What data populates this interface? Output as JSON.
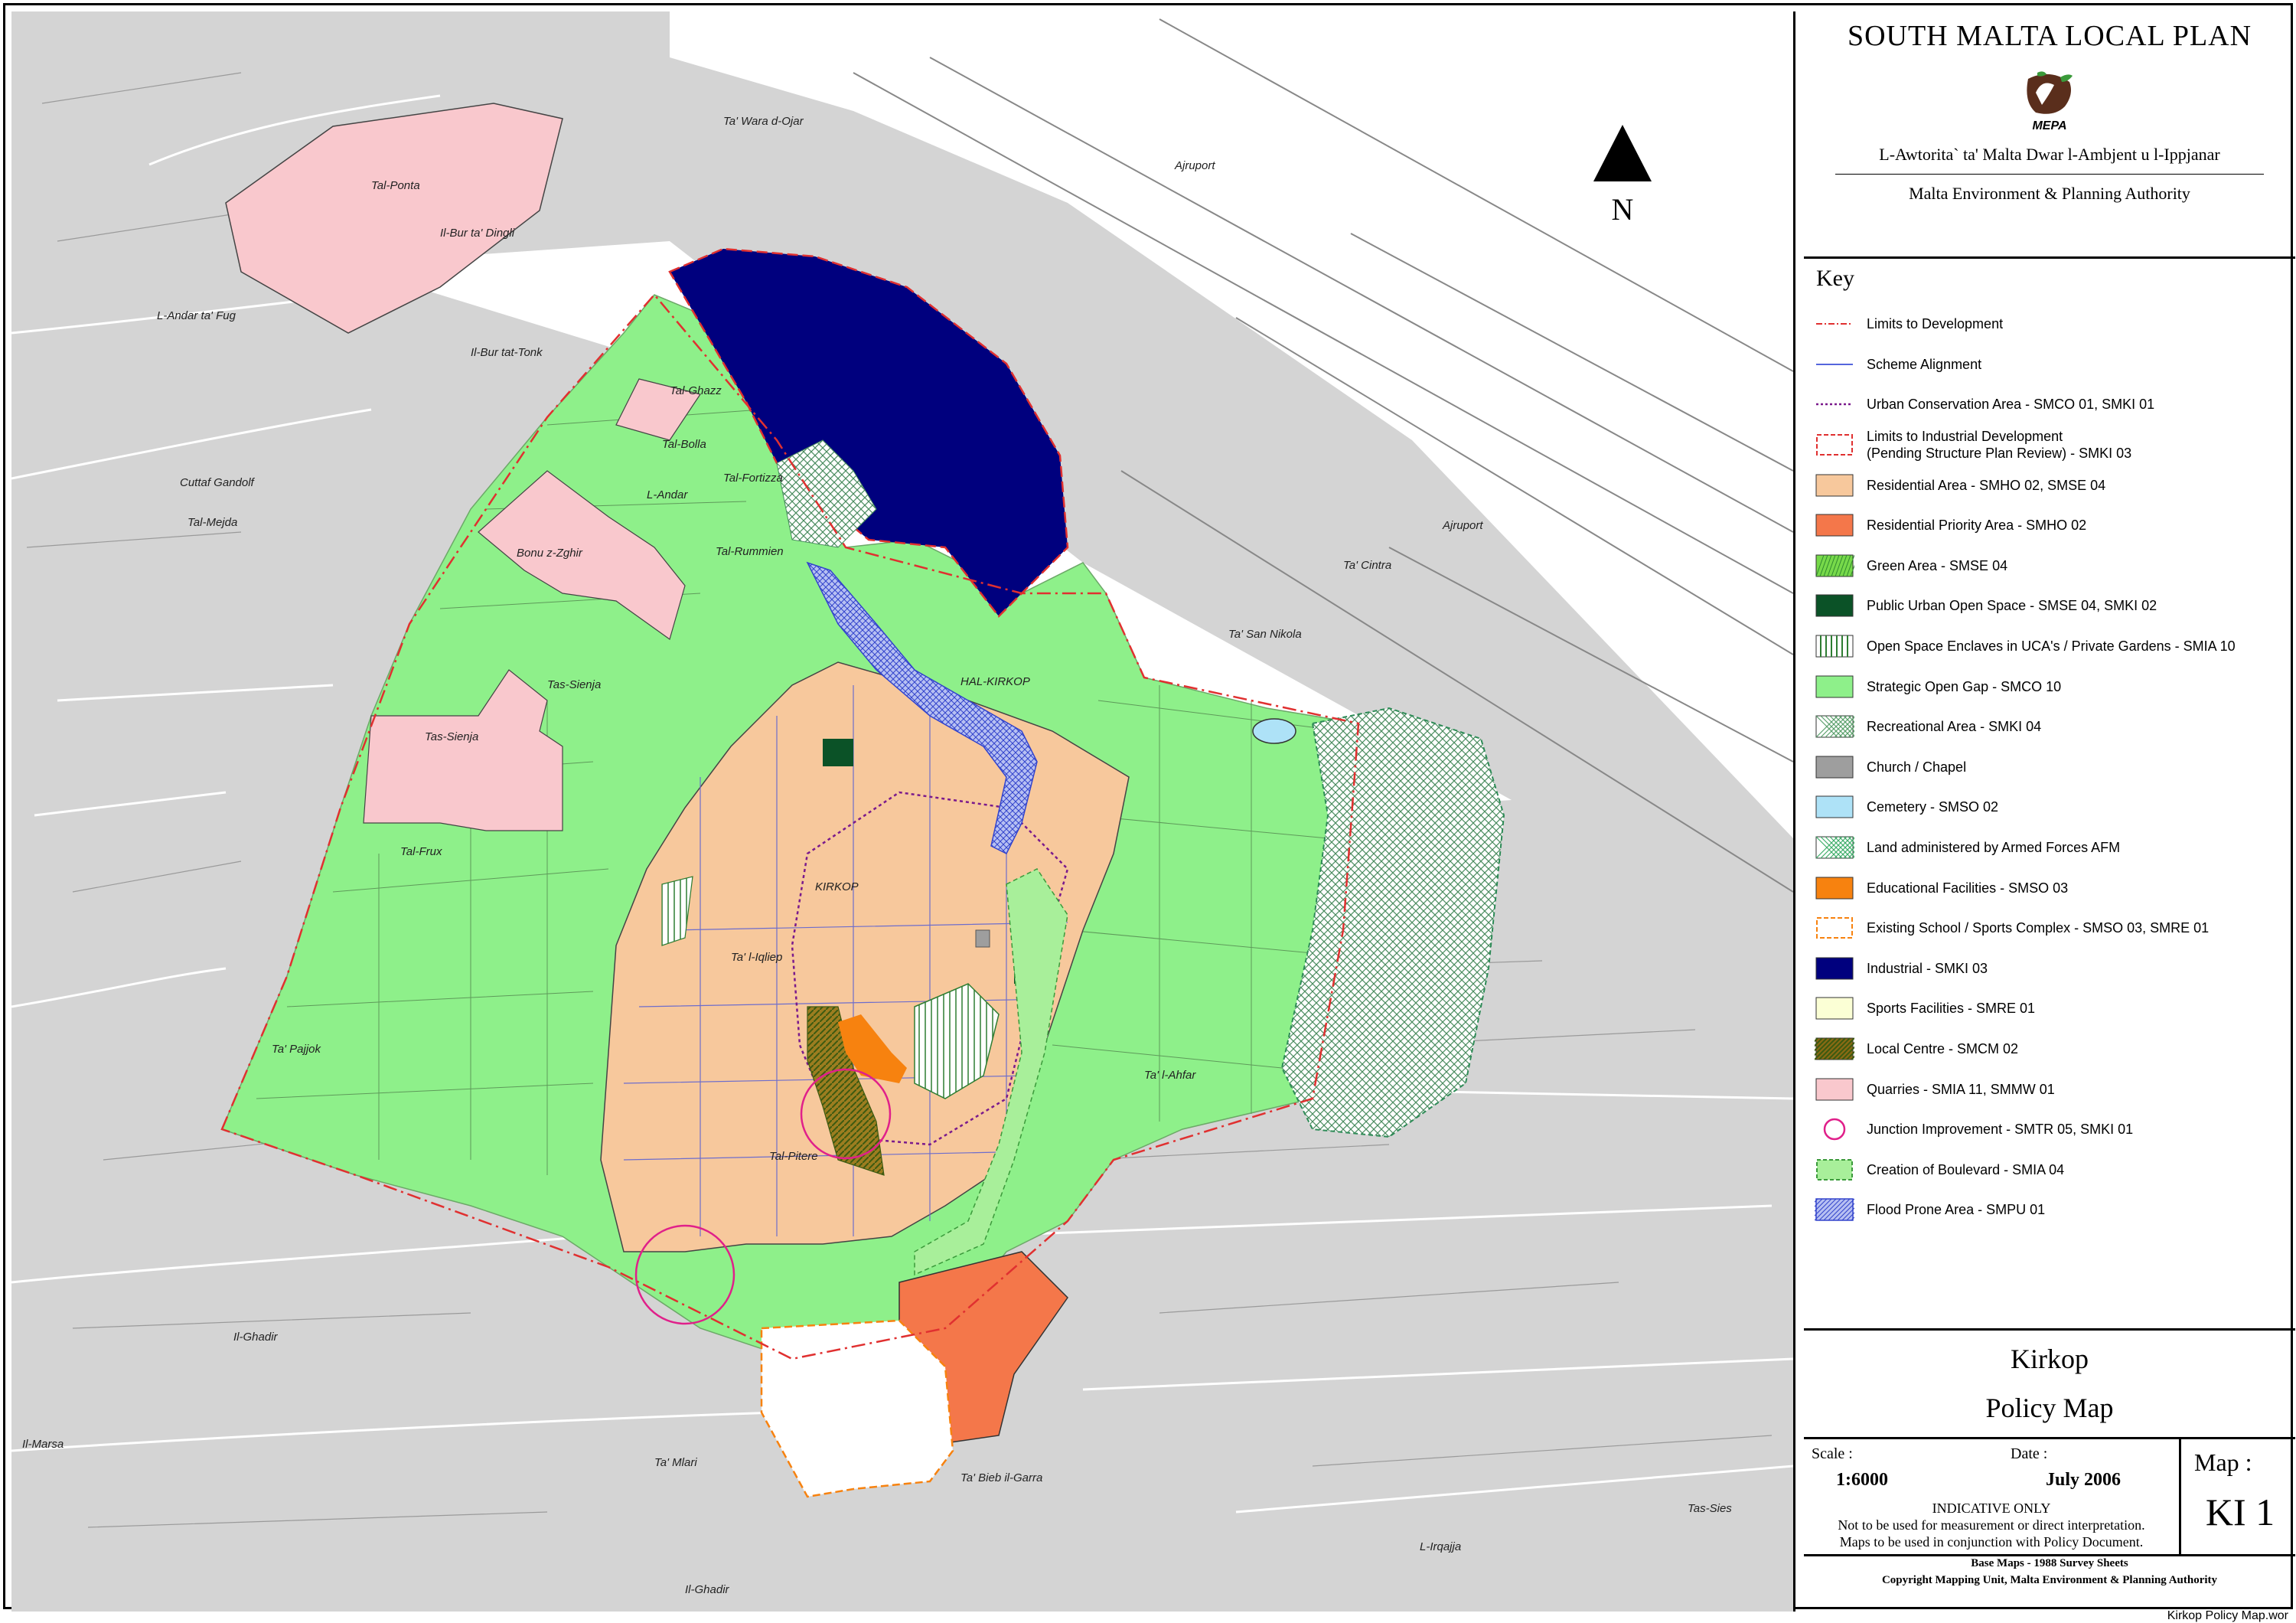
{
  "title": "SOUTH MALTA LOCAL PLAN",
  "logo_text": "MEPA",
  "authority_mt": "L-Awtorita` ta' Malta Dwar l-Ambjent u l-Ippjanar",
  "authority_en": "Malta Environment & Planning Authority",
  "north_label": "N",
  "key": {
    "title": "Key",
    "items": [
      {
        "label": "Limits to Development",
        "symbol": "dashdot-red"
      },
      {
        "label": "Scheme Alignment",
        "symbol": "line-blue"
      },
      {
        "label": "Urban Conservation Area - SMCO 01, SMKI 01",
        "symbol": "dotted-purple"
      },
      {
        "label": "Limits to Industrial Development\n(Pending Structure Plan Review) - SMKI 03",
        "symbol": "dashed-red-box"
      },
      {
        "label": "Residential Area - SMHO 02, SMSE 04",
        "symbol": "fill",
        "color": "#f7c89c"
      },
      {
        "label": "Residential Priority Area - SMHO 02",
        "symbol": "fill",
        "color": "#f4774a"
      },
      {
        "label": "Green Area - SMSE 04",
        "symbol": "hatch-green",
        "color": "#77d94a"
      },
      {
        "label": "Public Urban Open Space - SMSE 04, SMKI 02",
        "symbol": "fill",
        "color": "#0b5227"
      },
      {
        "label": "Open Space Enclaves in UCA's / Private Gardens - SMIA 10",
        "symbol": "vlines",
        "color": "#2e7d32"
      },
      {
        "label": "Strategic Open Gap - SMCO 10",
        "symbol": "fill",
        "color": "#8ef08a"
      },
      {
        "label": "Recreational Area - SMKI 04",
        "symbol": "grid",
        "color": "#5aa06b"
      },
      {
        "label": "Church / Chapel",
        "symbol": "fill",
        "color": "#9e9e9e"
      },
      {
        "label": "Cemetery - SMSO 02",
        "symbol": "fill",
        "color": "#aee2f7"
      },
      {
        "label": "Land administered by Armed Forces AFM",
        "symbol": "check",
        "color": "#3fae6a"
      },
      {
        "label": "Educational Facilities - SMSO 03",
        "symbol": "fill",
        "color": "#f7820f"
      },
      {
        "label": "Existing School / Sports Complex - SMSO 03, SMRE 01",
        "symbol": "dashed-orange-box"
      },
      {
        "label": "Industrial - SMKI 03",
        "symbol": "fill",
        "color": "#00007e"
      },
      {
        "label": "Sports Facilities - SMRE 01",
        "symbol": "fill",
        "color": "#fbffd5"
      },
      {
        "label": "Local Centre - SMCM 02",
        "symbol": "diag",
        "color": "#8a6a14"
      },
      {
        "label": "Quarries - SMIA 11, SMMW 01",
        "symbol": "fill",
        "color": "#f9c8cd"
      },
      {
        "label": "Junction Improvement - SMTR 05, SMKI 01",
        "symbol": "circle-magenta"
      },
      {
        "label": "Creation of Boulevard - SMIA 04",
        "symbol": "dashed-green-fill",
        "color": "#a8ef9a"
      },
      {
        "label": "Flood Prone Area - SMPU 01",
        "symbol": "flood",
        "color": "#4c5fd6"
      }
    ]
  },
  "place": {
    "name": "Kirkop",
    "subtitle": "Policy Map"
  },
  "meta": {
    "scale_label": "Scale :",
    "scale_value": "1:6000",
    "date_label": "Date :",
    "date_value": "July 2006",
    "indicative": "INDICATIVE ONLY",
    "note_1": "Not to be used for measurement or direct interpretation.",
    "note_2": "Maps to be used in conjunction with Policy Document.",
    "map_label": "Map :",
    "map_id": "KI 1"
  },
  "footer": {
    "line_1": "Base Maps - 1988 Survey Sheets",
    "line_2": "Copyright Mapping Unit, Malta Environment & Planning Authority"
  },
  "file_name": "Kirkop Policy Map.wor",
  "place_labels": {
    "ta_wara_d_ojar": "Ta' Wara d-Ojar",
    "tal_ponta": "Tal-Ponta",
    "il_bur_ta_dingli": "Il-Bur ta' Dingli",
    "l_andar_ta_fug": "L-Andar ta' Fug",
    "il_bur_tat_tonk": "Il-Bur tat-Tonk",
    "ajruport_1": "Ajruport",
    "ajruport_2": "Ajruport",
    "tal_ghazz": "Tal-Ghazz",
    "tal_bolla": "Tal-Bolla",
    "tal_fortizza": "Tal-Fortizza",
    "cuttaf_gandolf": "Cuttaf Gandolf",
    "l_andar": "L-Andar",
    "bonu_z_zghir": "Bonu z-Zghir",
    "tal_rummien": "Tal-Rummien",
    "tal_mejda": "Tal-Mejda",
    "ta_cintra": "Ta' Cintra",
    "ta_san_nikola": "Ta' San Nikola",
    "hal_kirkop": "HAL-KIRKOP",
    "tas_sienja_1": "Tas-Sienja",
    "tas_sienja_2": "Tas-Sienja",
    "tal_frux": "Tal-Frux",
    "kirkop": "KIRKOP",
    "ta_l_iqliep": "Ta' l-Iqliep",
    "ta_l_ahfar": "Ta' l-Ahfar",
    "ta_pajjok": "Ta' Pajjok",
    "tal_pitere": "Tal-Pitere",
    "il_ghadir": "Il-Ghadir",
    "il_marsa": "Il-Marsa",
    "ta_mlari": "Ta' Mlari",
    "ta_bieb_il_garra": "Ta' Bieb il-Garra",
    "l_irqajja": "L-Irqajja",
    "tas_sies": "Tas-Sies",
    "il_ghadir_2": "Il-Ghadir"
  },
  "colors": {
    "background_gray": "#d4d4d4",
    "strategic_gap": "#8ef08a",
    "residential": "#f7c89c",
    "industrial": "#00007e",
    "quarries": "#f9c8cd",
    "residential_priority": "#f4774a",
    "limit_red": "#e03030"
  }
}
